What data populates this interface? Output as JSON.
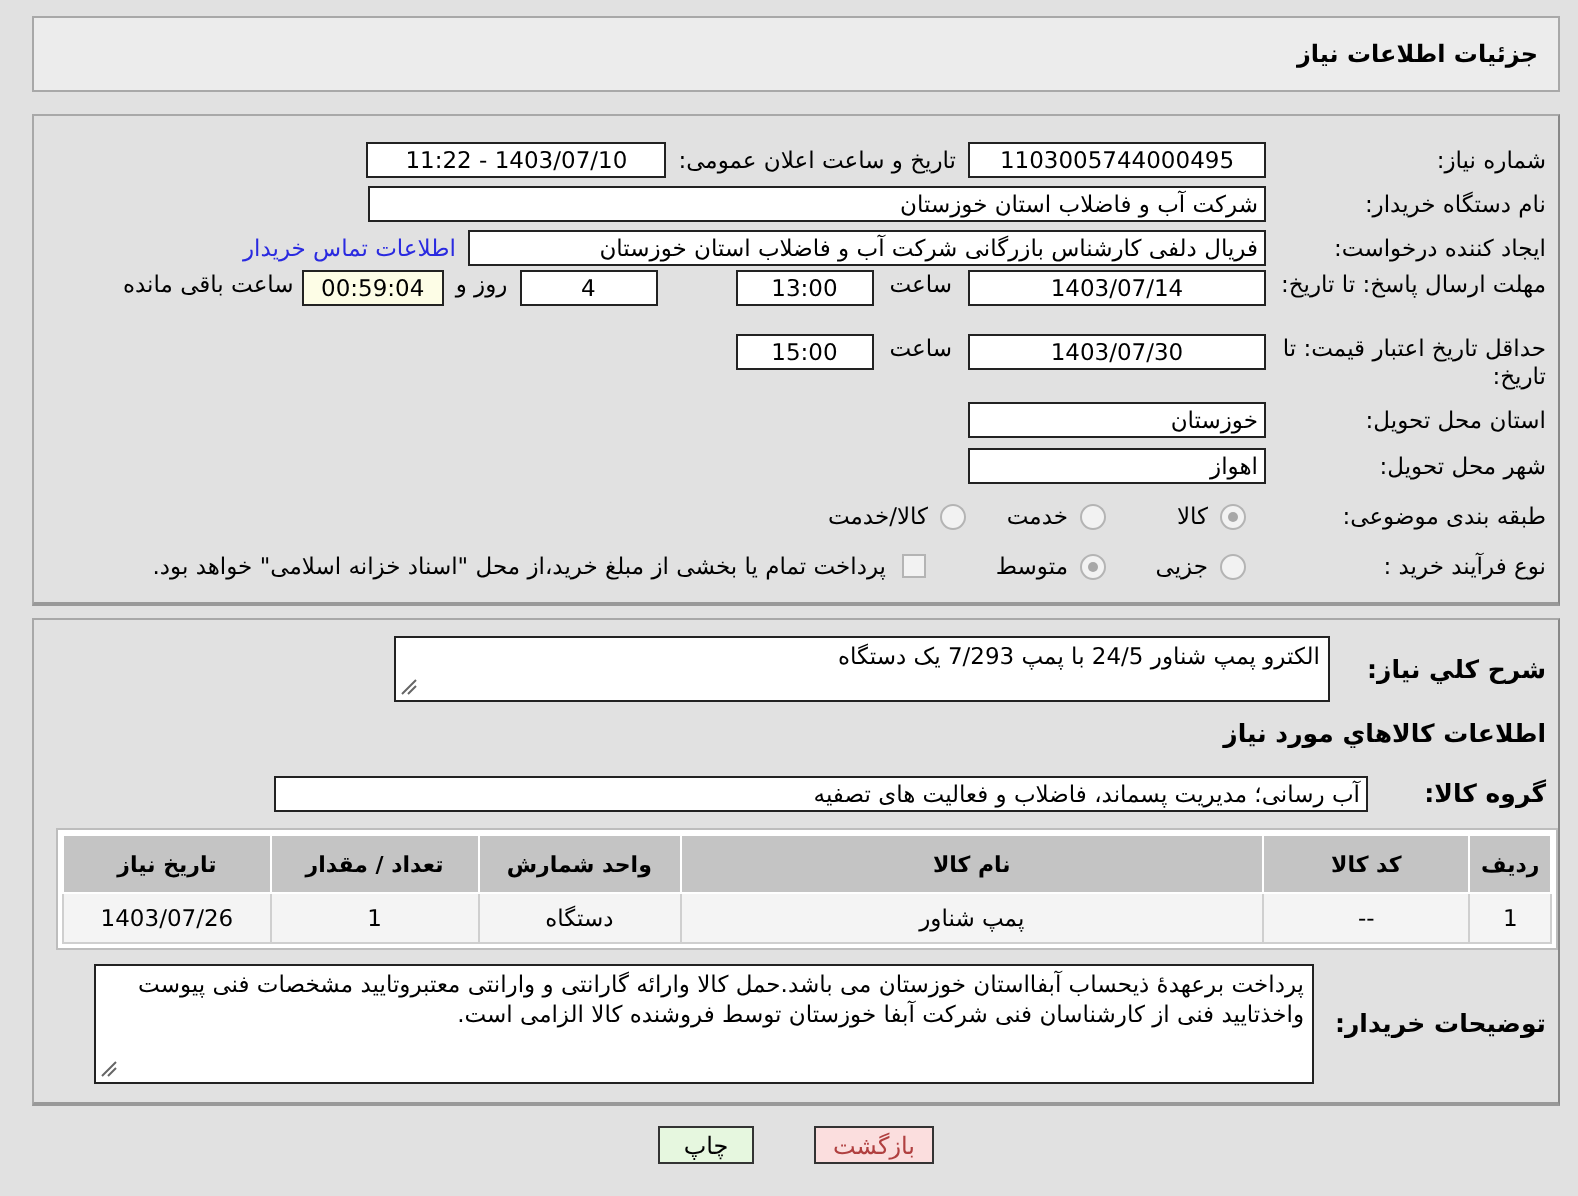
{
  "header": {
    "title": "جزئیات اطلاعات نیاز"
  },
  "need_number": {
    "label": "شماره نیاز:",
    "value": "1103005744000495"
  },
  "announce": {
    "label": "تاریخ و ساعت اعلان عمومی:",
    "value": "1403/07/10 - 11:22"
  },
  "buyer": {
    "label": "نام دستگاه خریدار:",
    "value": "شرکت آب و فاضلاب استان خوزستان"
  },
  "creator": {
    "label": "ایجاد کننده درخواست:",
    "value": "فریال دلفی کارشناس بازرگانی شرکت آب و فاضلاب استان خوزستان",
    "link": "اطلاعات تماس خریدار"
  },
  "deadline": {
    "label": "مهلت ارسال پاسخ: تا تاریخ:",
    "date": "1403/07/14",
    "time_label": "ساعت",
    "time": "13:00",
    "days": "4",
    "days_label": "روز و",
    "remaining": "00:59:04",
    "remaining_label": "ساعت باقی مانده"
  },
  "validity": {
    "label": "حداقل تاریخ اعتبار قیمت: تا تاریخ:",
    "date": "1403/07/30",
    "time_label": "ساعت",
    "time": "15:00"
  },
  "province": {
    "label": "استان محل تحویل:",
    "value": "خوزستان"
  },
  "city": {
    "label": "شهر محل تحویل:",
    "value": "اهواز"
  },
  "category": {
    "label": "طبقه بندی موضوعی:",
    "options": [
      {
        "label": "کالا",
        "selected": true
      },
      {
        "label": "خدمت",
        "selected": false
      },
      {
        "label": "کالا/خدمت",
        "selected": false
      }
    ]
  },
  "process": {
    "label": "نوع فرآیند خرید :",
    "options": [
      {
        "label": "جزیی",
        "selected": false
      },
      {
        "label": "متوسط",
        "selected": true
      }
    ],
    "treasury": {
      "label": "پرداخت تمام یا بخشی از مبلغ خرید،از محل \"اسناد خزانه اسلامی\" خواهد بود.",
      "checked": false
    }
  },
  "summary": {
    "label": "شرح کلي نیاز:",
    "value": "الکترو پمپ شناور 24/5 با پمپ 7/293 یک دستگاه"
  },
  "goods_heading": "اطلاعات کالاهاي مورد نیاز",
  "goods_group": {
    "label": "گروه کالا:",
    "value": "آب رسانی؛ مدیریت پسماند، فاضلاب و فعالیت های تصفیه"
  },
  "table": {
    "columns": [
      "ردیف",
      "کد کالا",
      "نام کالا",
      "واحد شمارش",
      "تعداد / مقدار",
      "تاریخ نیاز"
    ],
    "rows": [
      [
        "1",
        "--",
        "پمپ شناور",
        "دستگاه",
        "1",
        "1403/07/26"
      ]
    ]
  },
  "notes": {
    "label": "توضیحات خریدار:",
    "value": "پرداخت برعهدۀ ذیحساب آبفااستان خوزستان می باشد.حمل کالا وارائه گارانتی و وارانتی معتبروتایید مشخصات فنی پیوست واخذتایید فنی از کارشناسان فنی شرکت آبفا خوزستان توسط فروشنده کالا الزامی است."
  },
  "buttons": [
    {
      "kind": "back",
      "label": "بازگشت"
    },
    {
      "kind": "print",
      "label": "چاپ"
    }
  ]
}
